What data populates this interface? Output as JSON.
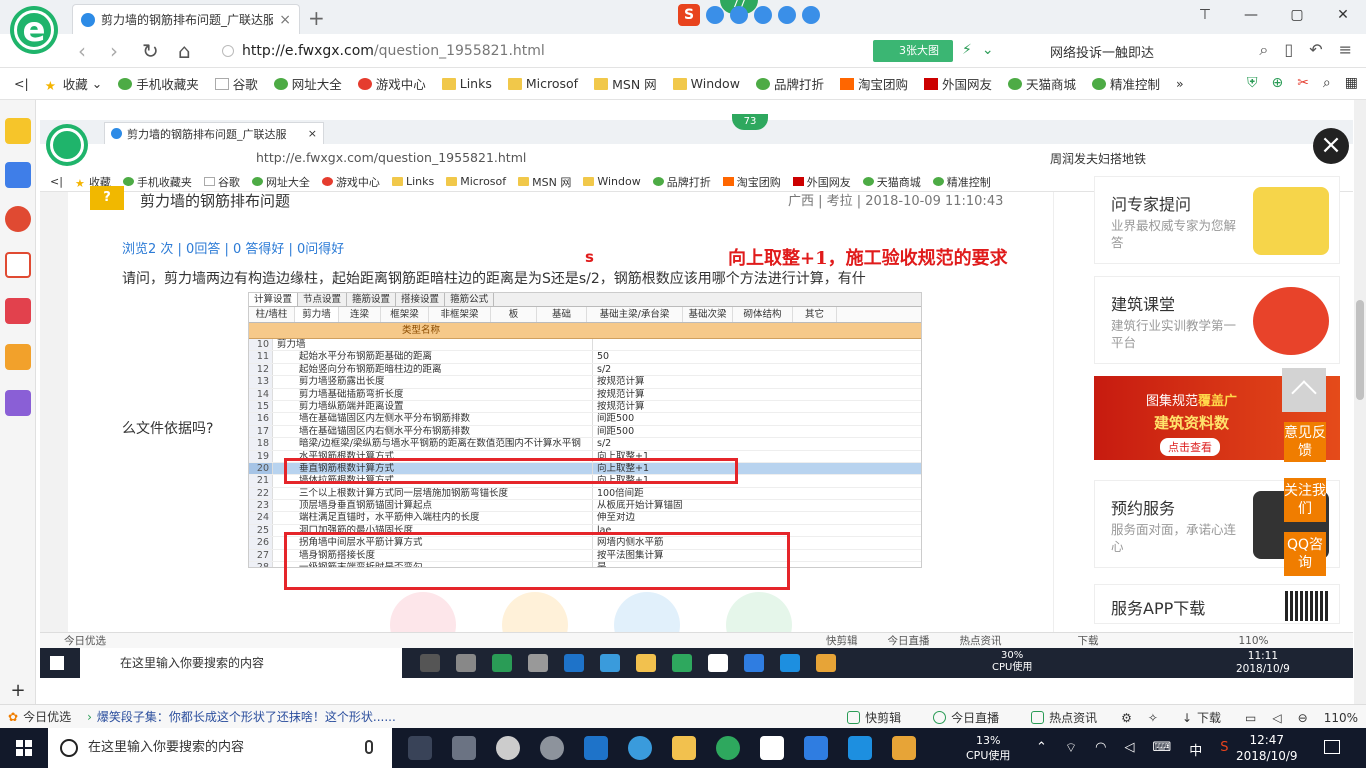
{
  "browser": {
    "tab_title": "剪力墙的钢筋排布问题_广联达服",
    "tab_close": "×",
    "new_tab": "+",
    "badge_count": "77",
    "url_host": "http://e.fwxgx.com",
    "url_path": "/question_1955821.html",
    "big_pic_label": "3张大图",
    "search_text": "网络投诉一触即达",
    "bookmarks": [
      "收藏",
      "手机收藏夹",
      "谷歌",
      "网址大全",
      "游戏中心",
      "Links",
      "Microsof",
      "MSN 网",
      "Window",
      "品牌打折",
      "淘宝团购",
      "外国网友",
      "天猫商城",
      "精准控制"
    ],
    "more_bookmarks": "»"
  },
  "inner": {
    "tab_title": "剪力墙的钢筋排布问题_广联达服",
    "badge_count": "73",
    "url": "http://e.fwxgx.com/question_1955821.html",
    "search_text": "周润发夫妇搭地铁",
    "bookmarks": [
      "收藏",
      "手机收藏夹",
      "谷歌",
      "网址大全",
      "游戏中心",
      "Links",
      "Microsof",
      "MSN 网",
      "Window",
      "品牌打折",
      "淘宝团购",
      "外国网友",
      "天猫商城",
      "精准控制"
    ],
    "status_left": "今日优选",
    "status_items": [
      "快剪辑",
      "今日直播",
      "热点资讯",
      "下载",
      "110%"
    ],
    "taskbar_search": "在这里输入你要搜索的内容",
    "cpu_pct": "30%",
    "cpu_label": "CPU使用",
    "time": "11:11",
    "date": "2018/10/9"
  },
  "question": {
    "title": "剪力墙的钢筋排布问题",
    "meta": "广西 | 考拉 | 2018-10-09 11:10:43",
    "stats": "浏览2 次 | 0回答 | 0 答得好 | 0问得好",
    "s_mark": "s",
    "annotation": "向上取整+1，施工验收规范的要求",
    "body_1": "请问，剪力墙两边有构造边缘柱，起始距离钢筋距暗柱边的距离是为S还是s/2，钢筋根数应该用哪个方法进行计算，有什",
    "body_2": "么文件依据吗?"
  },
  "settings_table": {
    "top_tabs": [
      "计算设置",
      "节点设置",
      "箍筋设置",
      "搭接设置",
      "箍筋公式"
    ],
    "sub_tabs": [
      "柱/墙柱",
      "剪力墙",
      "连梁",
      "框架梁",
      "非框架梁",
      "板",
      "基础",
      "基础主梁/承台梁",
      "基础次梁",
      "砌体结构",
      "其它"
    ],
    "header": "类型名称",
    "rows": [
      {
        "n": "10",
        "name": "剪力墙",
        "value": "",
        "group": true
      },
      {
        "n": "11",
        "name": "起始水平分布钢筋距基础的距离",
        "value": "50"
      },
      {
        "n": "12",
        "name": "起始竖向分布钢筋距暗柱边的距离",
        "value": "s/2"
      },
      {
        "n": "13",
        "name": "剪力墙竖筋露出长度",
        "value": "按规范计算"
      },
      {
        "n": "14",
        "name": "剪力墙基础插筋弯折长度",
        "value": "按规范计算"
      },
      {
        "n": "15",
        "name": "剪力墙纵筋端并距离设置",
        "value": "按规范计算"
      },
      {
        "n": "16",
        "name": "墙在基础锚固区内左侧水平分布钢筋排数",
        "value": "间距500"
      },
      {
        "n": "17",
        "name": "墙在基础锚固区内右侧水平分布钢筋排数",
        "value": "间距500"
      },
      {
        "n": "18",
        "name": "暗梁/边框梁/梁纵筋与墙水平钢筋的距离在数值范围内不计算水平钢",
        "value": "s/2"
      },
      {
        "n": "19",
        "name": "水平钢筋根数计算方式",
        "value": "向上取整+1"
      },
      {
        "n": "20",
        "name": "垂直钢筋根数计算方式",
        "value": "向上取整+1",
        "selected": true
      },
      {
        "n": "21",
        "name": "墙体拉筋根数计算方式",
        "value": "向上取整+1"
      },
      {
        "n": "22",
        "name": "三个以上根数计算方式同一层墙施加钢筋弯锚长度",
        "value": "100倍间距"
      },
      {
        "n": "23",
        "name": "顶层墙身垂直钢筋锚固计算起点",
        "value": "从板底开始计算锚固"
      },
      {
        "n": "24",
        "name": "端柱满足直锚时，水平筋伸入端柱内的长度",
        "value": "伸至对边"
      },
      {
        "n": "25",
        "name": "洞口加强筋的最小锚固长度",
        "value": "lae"
      },
      {
        "n": "26",
        "name": "拐角墙中间层水平筋计算方式",
        "value": "网墙内侧水平筋"
      },
      {
        "n": "27",
        "name": "墙身钢筋搭接长度",
        "value": "按平法图集计算"
      },
      {
        "n": "28",
        "name": "一级钢筋末端弯折时是否弯勾",
        "value": "是"
      }
    ]
  },
  "right_column": {
    "card1_title": "问专家提问",
    "card1_sub": "业界最权威专家为您解答",
    "card2_title": "建筑课堂",
    "card2_sub": "建筑行业实训教学第一平台",
    "banner_1a": "图集规范",
    "banner_1b": "覆盖广",
    "banner_2": "建筑资料数",
    "banner_btn": "点击查看",
    "card3_title": "预约服务",
    "card3_sub": "服务面对面，承诺心连心",
    "card4_title": "服务APP下载",
    "float_buttons": [
      "意见反馈",
      "关注我们",
      "QQ咨询"
    ],
    "close": "×"
  },
  "statusbar": {
    "left": "今日优选",
    "news": "爆笑段子集：你都长成这个形状了还抹啥！这个形状......",
    "items": [
      "快剪辑",
      "今日直播",
      "热点资讯",
      "下载"
    ],
    "zoom": "110%"
  },
  "taskbar": {
    "search_placeholder": "在这里输入你要搜索的内容",
    "cpu_pct": "13%",
    "cpu_label": "CPU使用",
    "ime": "中",
    "time": "12:47",
    "date": "2018/10/9"
  }
}
